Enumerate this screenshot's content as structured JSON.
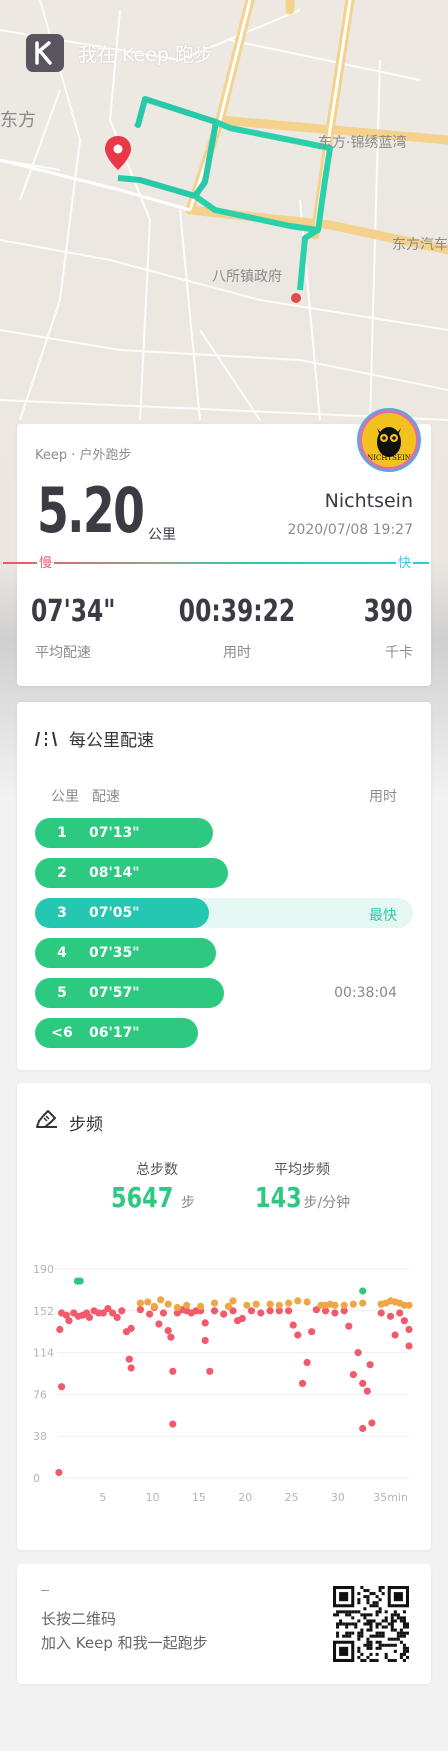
{
  "brand": {
    "title": "我在 Keep 跑步"
  },
  "map": {
    "labels": [
      "东方",
      "东方·锦绣蓝湾",
      "东方汽车",
      "八所镇政府"
    ]
  },
  "summary": {
    "activity": "Keep · 户外跑步",
    "distance": "5.20",
    "distance_unit": "公里",
    "user": "Nichtsein",
    "avatar_text": "NICHTSEIN",
    "datetime": "2020/07/08 19:27",
    "slow_label": "慢",
    "fast_label": "快",
    "stats": [
      {
        "value": "07'34\"",
        "label": "平均配速"
      },
      {
        "value": "00:39:22",
        "label": "用时"
      },
      {
        "value": "390",
        "label": "千卡"
      }
    ]
  },
  "pace": {
    "title": "每公里配速",
    "col_km": "公里",
    "col_pace": "配速",
    "col_time": "用时",
    "rows": [
      {
        "km": "1",
        "pace": "07'13\"",
        "fraction": 0.47,
        "note": ""
      },
      {
        "km": "2",
        "pace": "08'14\"",
        "fraction": 0.51,
        "note": ""
      },
      {
        "km": "3",
        "pace": "07'05\"",
        "fraction": 0.46,
        "note": "最快"
      },
      {
        "km": "4",
        "pace": "07'35\"",
        "fraction": 0.48,
        "note": ""
      },
      {
        "km": "5",
        "pace": "07'57\"",
        "fraction": 0.5,
        "note": "00:38:04"
      },
      {
        "km": "<6",
        "pace": "06'17\"",
        "fraction": 0.43,
        "note": ""
      }
    ]
  },
  "cadence": {
    "title": "步频",
    "total_steps_label": "总步数",
    "total_steps": "5647",
    "total_steps_unit": "步",
    "avg_label": "平均步频",
    "avg_value": "143",
    "avg_unit": "步/分钟"
  },
  "chart_data": {
    "type": "scatter",
    "yticks": [
      "190",
      "152",
      "114",
      "76",
      "38",
      "0"
    ],
    "xticks": [
      "5",
      "10",
      "15",
      "20",
      "25",
      "30",
      "35min"
    ],
    "ylim": [
      0,
      190
    ],
    "xlim": [
      0,
      38
    ],
    "grid": true,
    "series": [
      {
        "color": "#f05a6a",
        "points": [
          [
            0.2,
            5
          ],
          [
            0.3,
            135
          ],
          [
            0.5,
            150
          ],
          [
            0.5,
            83
          ],
          [
            1,
            148
          ],
          [
            1.3,
            143
          ],
          [
            1.8,
            150
          ],
          [
            2.3,
            147
          ],
          [
            2.8,
            148
          ],
          [
            3.2,
            150
          ],
          [
            3.5,
            146
          ],
          [
            4,
            152
          ],
          [
            4.5,
            150
          ],
          [
            5,
            150
          ],
          [
            5.5,
            154
          ],
          [
            6,
            150
          ],
          [
            6.5,
            146
          ],
          [
            7,
            152
          ],
          [
            7.5,
            133
          ],
          [
            7.8,
            108
          ],
          [
            8,
            100
          ],
          [
            8,
            136
          ],
          [
            9,
            153
          ],
          [
            10,
            149
          ],
          [
            10.5,
            155
          ],
          [
            11,
            140
          ],
          [
            11.5,
            150
          ],
          [
            12,
            134
          ],
          [
            12.3,
            128
          ],
          [
            12.5,
            97
          ],
          [
            12.5,
            49
          ],
          [
            13,
            150
          ],
          [
            13.5,
            153
          ],
          [
            14,
            152
          ],
          [
            14.5,
            150
          ],
          [
            15,
            152
          ],
          [
            15.5,
            152
          ],
          [
            16,
            141
          ],
          [
            16,
            125
          ],
          [
            16.5,
            97
          ],
          [
            17,
            152
          ],
          [
            18,
            149
          ],
          [
            19,
            152
          ],
          [
            19.5,
            143
          ],
          [
            20,
            145
          ],
          [
            21,
            152
          ],
          [
            22,
            150
          ],
          [
            23,
            152
          ],
          [
            24,
            152
          ],
          [
            25,
            152
          ],
          [
            25.5,
            139
          ],
          [
            26,
            130
          ],
          [
            26.5,
            86
          ],
          [
            27,
            105
          ],
          [
            27.5,
            133
          ],
          [
            28,
            153
          ],
          [
            29,
            152
          ],
          [
            30,
            150
          ],
          [
            31,
            152
          ],
          [
            31.5,
            138
          ],
          [
            32,
            94
          ],
          [
            32.5,
            114
          ],
          [
            33,
            45
          ],
          [
            33,
            86
          ],
          [
            33.5,
            79
          ],
          [
            33.8,
            103
          ],
          [
            34,
            50
          ],
          [
            35,
            150
          ],
          [
            36,
            147
          ],
          [
            37,
            150
          ],
          [
            37.5,
            143
          ],
          [
            38,
            120
          ],
          [
            38,
            135
          ],
          [
            36.5,
            130
          ]
        ]
      },
      {
        "color": "#f0a646",
        "points": [
          [
            9,
            159
          ],
          [
            9.8,
            160
          ],
          [
            10.5,
            156
          ],
          [
            11.2,
            162
          ],
          [
            12,
            158
          ],
          [
            13,
            155
          ],
          [
            14,
            157
          ],
          [
            15.5,
            156
          ],
          [
            17,
            159
          ],
          [
            18.5,
            156
          ],
          [
            19,
            161
          ],
          [
            20.5,
            157
          ],
          [
            21.5,
            158
          ],
          [
            23,
            158
          ],
          [
            24,
            157
          ],
          [
            25,
            159
          ],
          [
            26,
            161
          ],
          [
            27,
            160
          ],
          [
            28.5,
            157
          ],
          [
            29,
            157
          ],
          [
            29.5,
            158
          ],
          [
            30,
            157
          ],
          [
            31,
            157
          ],
          [
            32,
            158
          ],
          [
            33,
            159
          ],
          [
            35,
            158
          ],
          [
            35.5,
            159
          ],
          [
            36,
            161
          ],
          [
            36.5,
            160
          ],
          [
            37,
            159
          ],
          [
            37.5,
            157
          ],
          [
            38,
            157
          ]
        ]
      },
      {
        "color": "#2ec981",
        "points": [
          [
            2.2,
            179
          ],
          [
            2.5,
            179
          ],
          [
            33,
            170
          ]
        ]
      }
    ]
  },
  "qr": {
    "line1": "长按二维码",
    "line2": "加入 Keep 和我一起跑步"
  }
}
